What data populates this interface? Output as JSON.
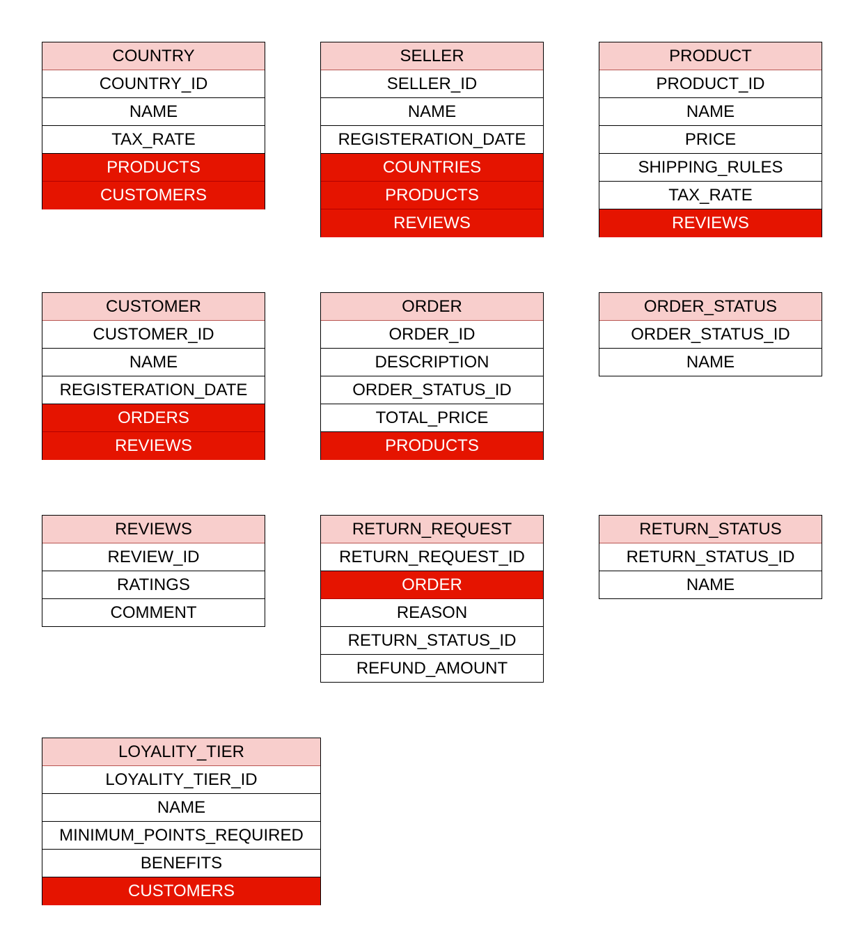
{
  "entities": {
    "country": {
      "name": "COUNTRY",
      "rows": [
        {
          "label": "COUNTRY_ID"
        },
        {
          "label": "NAME"
        },
        {
          "label": "TAX_RATE"
        },
        {
          "label": "PRODUCTS"
        },
        {
          "label": "CUSTOMERS"
        }
      ]
    },
    "seller": {
      "name": "SELLER",
      "rows": [
        {
          "label": "SELLER_ID"
        },
        {
          "label": "NAME"
        },
        {
          "label": "REGISTERATION_DATE"
        },
        {
          "label": "COUNTRIES"
        },
        {
          "label": "PRODUCTS"
        },
        {
          "label": "REVIEWS"
        }
      ]
    },
    "product": {
      "name": "PRODUCT",
      "rows": [
        {
          "label": "PRODUCT_ID"
        },
        {
          "label": "NAME"
        },
        {
          "label": "PRICE"
        },
        {
          "label": "SHIPPING_RULES"
        },
        {
          "label": "TAX_RATE"
        },
        {
          "label": "REVIEWS"
        }
      ]
    },
    "customer": {
      "name": "CUSTOMER",
      "rows": [
        {
          "label": "CUSTOMER_ID"
        },
        {
          "label": "NAME"
        },
        {
          "label": "REGISTERATION_DATE"
        },
        {
          "label": "ORDERS"
        },
        {
          "label": "REVIEWS"
        }
      ]
    },
    "order": {
      "name": "ORDER",
      "rows": [
        {
          "label": "ORDER_ID"
        },
        {
          "label": "DESCRIPTION"
        },
        {
          "label": "ORDER_STATUS_ID"
        },
        {
          "label": "TOTAL_PRICE"
        },
        {
          "label": "PRODUCTS"
        }
      ]
    },
    "order_status": {
      "name": "ORDER_STATUS",
      "rows": [
        {
          "label": "ORDER_STATUS_ID"
        },
        {
          "label": "NAME"
        }
      ]
    },
    "reviews": {
      "name": "REVIEWS",
      "rows": [
        {
          "label": "REVIEW_ID"
        },
        {
          "label": "RATINGS"
        },
        {
          "label": "COMMENT"
        }
      ]
    },
    "return_request": {
      "name": "RETURN_REQUEST",
      "rows": [
        {
          "label": "RETURN_REQUEST_ID"
        },
        {
          "label": "ORDER"
        },
        {
          "label": "REASON"
        },
        {
          "label": "RETURN_STATUS_ID"
        },
        {
          "label": "REFUND_AMOUNT"
        }
      ]
    },
    "return_status": {
      "name": "RETURN_STATUS",
      "rows": [
        {
          "label": "RETURN_STATUS_ID"
        },
        {
          "label": "NAME"
        }
      ]
    },
    "loyality_tier": {
      "name": "LOYALITY_TIER",
      "rows": [
        {
          "label": "LOYALITY_TIER_ID"
        },
        {
          "label": "NAME"
        },
        {
          "label": "MINIMUM_POINTS_REQUIRED"
        },
        {
          "label": "BENEFITS"
        },
        {
          "label": "CUSTOMERS"
        }
      ]
    }
  },
  "colors": {
    "header_fill": "#f8cecc",
    "relation_fill": "#e51400",
    "relation_text": "#ffffff",
    "border": "#000000"
  }
}
